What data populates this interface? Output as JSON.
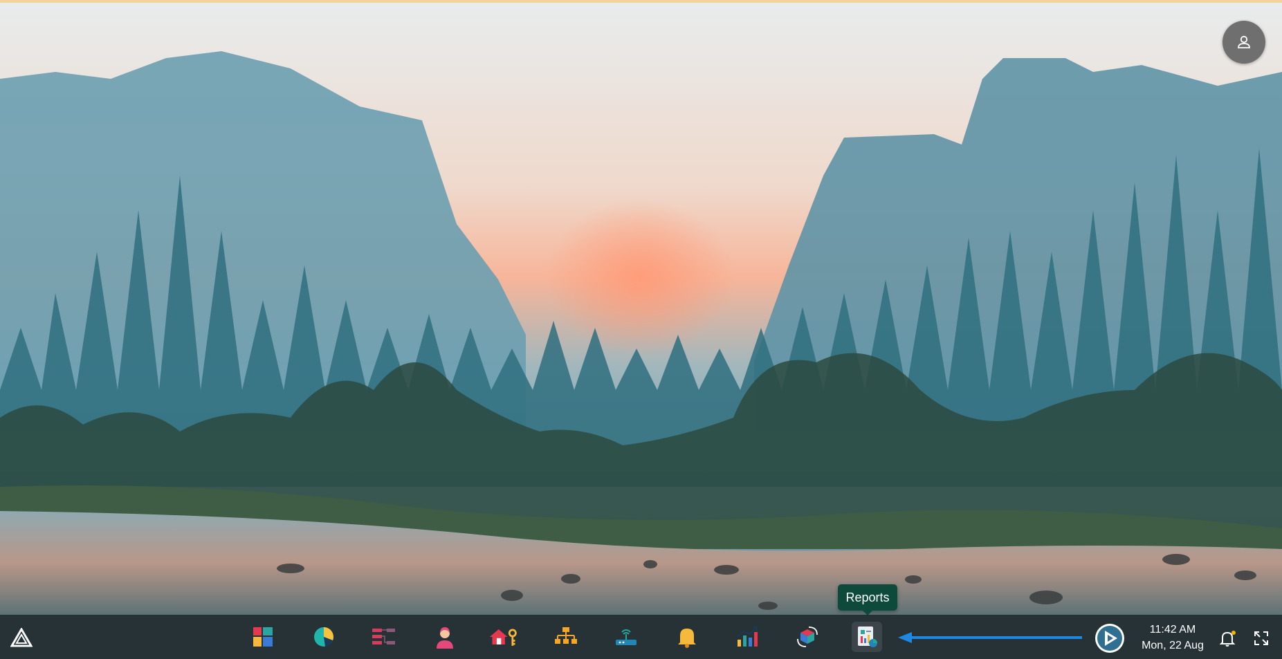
{
  "desktop": {
    "wallpaper_icon": "landscape-wallpaper",
    "colors": {
      "accent_strip": "#f2d49a",
      "taskbar_bg": "#1c2224"
    }
  },
  "user_menu": {
    "icon": "user-icon"
  },
  "taskbar": {
    "start_icon": "triangle-logo-icon",
    "apps": [
      {
        "icon": "dashboard-icon"
      },
      {
        "icon": "pie-chart-icon"
      },
      {
        "icon": "workflow-icon"
      },
      {
        "icon": "user-agent-icon"
      },
      {
        "icon": "home-key-icon"
      },
      {
        "icon": "org-chart-icon"
      },
      {
        "icon": "router-icon"
      },
      {
        "icon": "bell-app-icon"
      },
      {
        "icon": "growth-chart-icon"
      },
      {
        "icon": "cube-sync-icon"
      },
      {
        "icon": "reports-icon",
        "active": true
      }
    ],
    "tooltip": "Reports",
    "arrow_color": "#1e88e5",
    "brand_icon": "play-brand-logo",
    "clock": {
      "time": "11:42 AM",
      "date": "Mon, 22 Aug"
    },
    "notification_icon": "notification-bell-icon",
    "notification_dot_color": "#f5b400",
    "fullscreen_icon": "fullscreen-icon"
  }
}
